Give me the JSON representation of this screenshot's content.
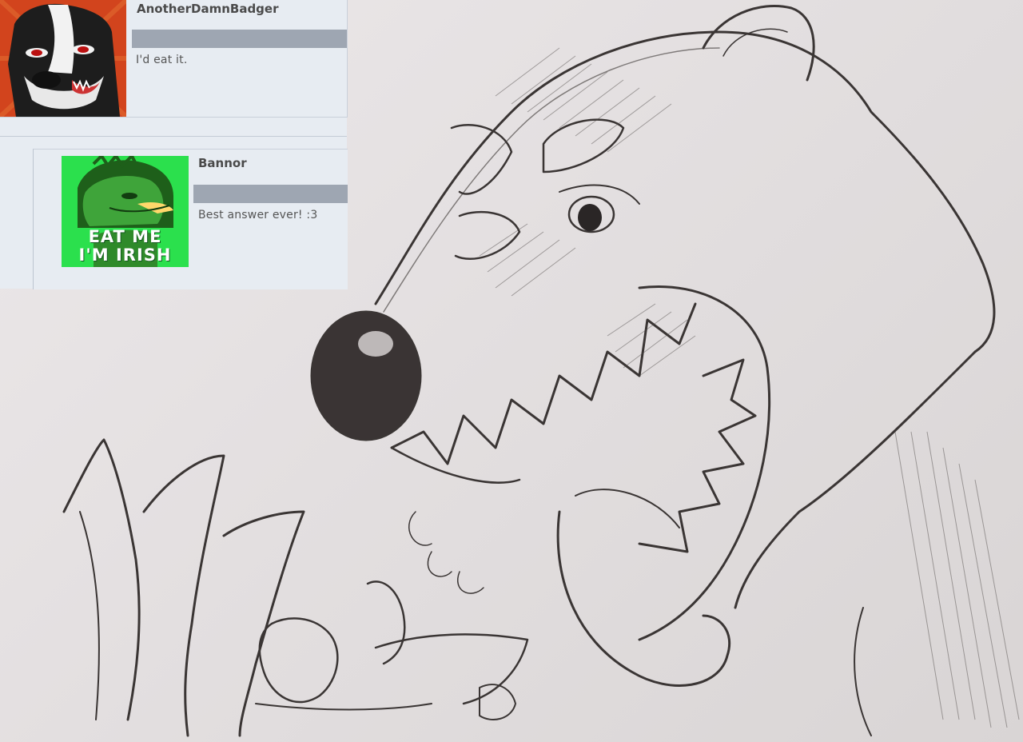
{
  "comments": [
    {
      "username": "AnotherDamnBadger",
      "text": "I'd eat it.",
      "avatar_icon": "badger-avatar-icon"
    },
    {
      "username": "Bannor",
      "text": "Best answer ever! :3",
      "avatar_icon": "green-creature-avatar-icon",
      "avatar_caption": [
        "EAT ME",
        "I'M IRISH"
      ]
    }
  ],
  "colors": {
    "comment_bg": "#e7ecf2",
    "info_bar": "#9ea6b2",
    "badger_avatar_bg": "#d2441d",
    "irish_avatar_bg": "#2be04d",
    "pencil": "#3a3534"
  }
}
